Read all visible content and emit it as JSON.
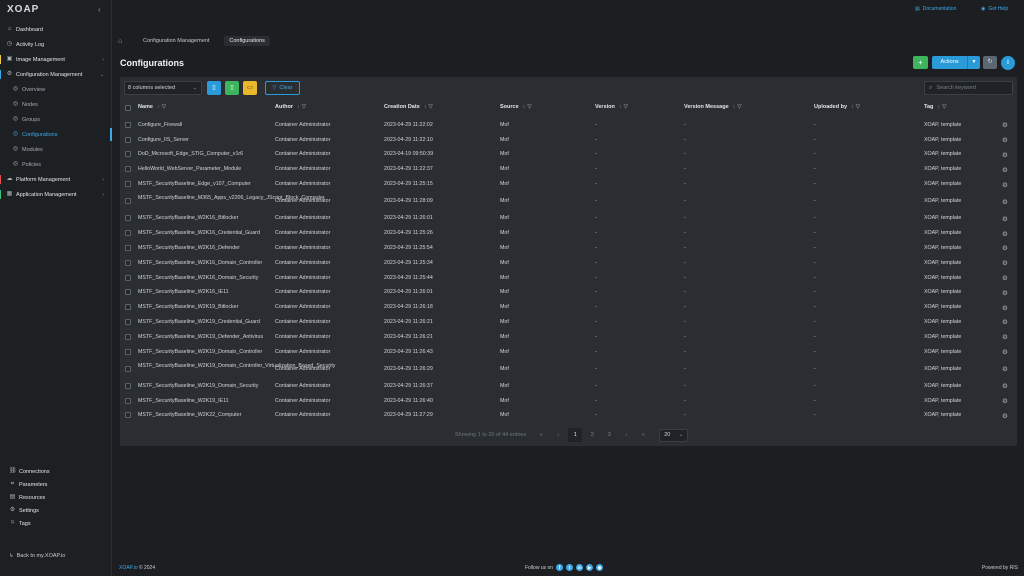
{
  "app": {
    "logo": "XOAP"
  },
  "sidebar": {
    "items": [
      {
        "label": "Dashboard",
        "icon": "home-icon"
      },
      {
        "label": "Activity Log",
        "icon": "clock-icon"
      },
      {
        "label": "Image Management",
        "icon": "image-icon"
      },
      {
        "label": "Configuration Management",
        "icon": "settings-icon"
      },
      {
        "label": "Overview",
        "icon": "grid-icon"
      },
      {
        "label": "Nodes",
        "icon": "server-icon"
      },
      {
        "label": "Groups",
        "icon": "group-icon"
      },
      {
        "label": "Configurations",
        "icon": "config-icon"
      },
      {
        "label": "Modules",
        "icon": "module-icon"
      },
      {
        "label": "Policies",
        "icon": "policy-icon"
      },
      {
        "label": "Platform Management",
        "icon": "cloud-icon"
      },
      {
        "label": "Application Management",
        "icon": "apps-icon"
      }
    ],
    "bottom": [
      {
        "label": "Connections",
        "icon": "link-icon"
      },
      {
        "label": "Parameters",
        "icon": "sliders-icon"
      },
      {
        "label": "Resources",
        "icon": "box-icon"
      },
      {
        "label": "Settings",
        "icon": "gear-icon"
      },
      {
        "label": "Tags",
        "icon": "tag-icon"
      }
    ],
    "back_link": "Back to my.XOAP.io"
  },
  "topbar": {
    "documentation": "Documentation",
    "help": "Get Help"
  },
  "breadcrumb": {
    "items": [
      "Configuration Management",
      "Configurations"
    ]
  },
  "page": {
    "title": "Configurations"
  },
  "actions": {
    "add": "+",
    "actions_label": "Actions",
    "refresh": "↻",
    "info": "i"
  },
  "toolbar": {
    "columns_selected": "8 columns selected",
    "clear": "Clear",
    "search_placeholder": "Search keyword"
  },
  "table": {
    "headers": [
      "Name",
      "Author",
      "Creation Date",
      "Source",
      "Version",
      "Version Message",
      "Uploaded by",
      "Tag"
    ],
    "rows": [
      [
        "Configure_Firewall",
        "Container Administrator",
        "2023-04-29 11:22:02",
        "Mof",
        "-",
        "-",
        "-",
        "XOAP, template"
      ],
      [
        "Configure_IIS_Server",
        "Container Administrator",
        "2023-04-29 11:22:10",
        "Mof",
        "-",
        "-",
        "-",
        "XOAP, template"
      ],
      [
        "DoD_Microsoft_Edge_STIG_Computer_v1r6",
        "Container Administrator",
        "2023-04-19 09:50:39",
        "Mof",
        "-",
        "-",
        "-",
        "XOAP, template"
      ],
      [
        "HelloWorld_WebServer_Parameter_Module",
        "Container Administrator",
        "2023-04-29 11:22:37",
        "Mof",
        "-",
        "-",
        "-",
        "XOAP, template"
      ],
      [
        "MSTF_SecurityBaseline_Edge_v107_Computer",
        "Container Administrator",
        "2023-04-29 11:25:15",
        "Mof",
        "-",
        "-",
        "-",
        "XOAP, template"
      ],
      [
        "MSTF_SecurityBaseline_M365_Apps_v2206_Legacy_JScript_Block_Computer",
        "Container Administrator",
        "2023-04-29 11:28:09",
        "Mof",
        "-",
        "-",
        "-",
        "XOAP, template"
      ],
      [
        "MSTF_SecurityBaseline_W2K16_Bitlocker",
        "Container Administrator",
        "2023-04-29 11:26:01",
        "Mof",
        "-",
        "-",
        "-",
        "XOAP, template"
      ],
      [
        "MSTF_SecurityBaseline_W2K16_Credential_Guard",
        "Container Administrator",
        "2023-04-29 11:25:26",
        "Mof",
        "-",
        "-",
        "-",
        "XOAP, template"
      ],
      [
        "MSTF_SecurityBaseline_W2K16_Defender",
        "Container Administrator",
        "2023-04-29 11:25:54",
        "Mof",
        "-",
        "-",
        "-",
        "XOAP, template"
      ],
      [
        "MSTF_SecurityBaseline_W2K16_Domain_Controller",
        "Container Administrator",
        "2023-04-29 11:25:34",
        "Mof",
        "-",
        "-",
        "-",
        "XOAP, template"
      ],
      [
        "MSTF_SecurityBaseline_W2K16_Domain_Security",
        "Container Administrator",
        "2023-04-29 11:25:44",
        "Mof",
        "-",
        "-",
        "-",
        "XOAP, template"
      ],
      [
        "MSTF_SecurityBaseline_W2K16_IE11",
        "Container Administrator",
        "2023-04-29 11:26:01",
        "Mof",
        "-",
        "-",
        "-",
        "XOAP, template"
      ],
      [
        "MSTF_SecurityBaseline_W2K19_Bitlocker",
        "Container Administrator",
        "2023-04-29 11:26:18",
        "Mof",
        "-",
        "-",
        "-",
        "XOAP, template"
      ],
      [
        "MSTF_SecurityBaseline_W2K19_Credential_Guard",
        "Container Administrator",
        "2023-04-29 11:26:21",
        "Mof",
        "-",
        "-",
        "-",
        "XOAP, template"
      ],
      [
        "MSTF_SecurityBaseline_W2K19_Defender_Antivirus",
        "Container Administrator",
        "2023-04-29 11:26:21",
        "Mof",
        "-",
        "-",
        "-",
        "XOAP, template"
      ],
      [
        "MSTF_SecurityBaseline_W2K19_Domain_Controller",
        "Container Administrator",
        "2023-04-29 11:26:43",
        "Mof",
        "-",
        "-",
        "-",
        "XOAP, template"
      ],
      [
        "MSTF_SecurityBaseline_W2K19_Domain_Controller_Virtualization_Based_Security",
        "Container Administrator",
        "2023-04-29 11:26:29",
        "Mof",
        "-",
        "-",
        "-",
        "XOAP, template"
      ],
      [
        "MSTF_SecurityBaseline_W2K19_Domain_Security",
        "Container Administrator",
        "2023-04-29 11:26:37",
        "Mof",
        "-",
        "-",
        "-",
        "XOAP, template"
      ],
      [
        "MSTF_SecurityBaseline_W2K19_IE11",
        "Container Administrator",
        "2023-04-29 11:26:40",
        "Mof",
        "-",
        "-",
        "-",
        "XOAP, template"
      ],
      [
        "MSTF_SecurityBaseline_W2K22_Computer",
        "Container Administrator",
        "2023-04-29 11:27:29",
        "Mof",
        "-",
        "-",
        "-",
        "XOAP, template"
      ]
    ]
  },
  "pagination": {
    "info": "Showing 1 to 20 of 44 entries",
    "pages": [
      "1",
      "2",
      "3"
    ],
    "current": "1",
    "page_size": "20"
  },
  "footer": {
    "brand": "XOAP.io",
    "copyright": "© 2024",
    "follow": "Follow us on",
    "powered": "Powered by RIS"
  },
  "colors": {
    "accent": "#3fa9e6",
    "add": "#3cb55c",
    "warning": "#e8b72c",
    "background": "#1c1e21",
    "panel": "#2a2e33"
  }
}
